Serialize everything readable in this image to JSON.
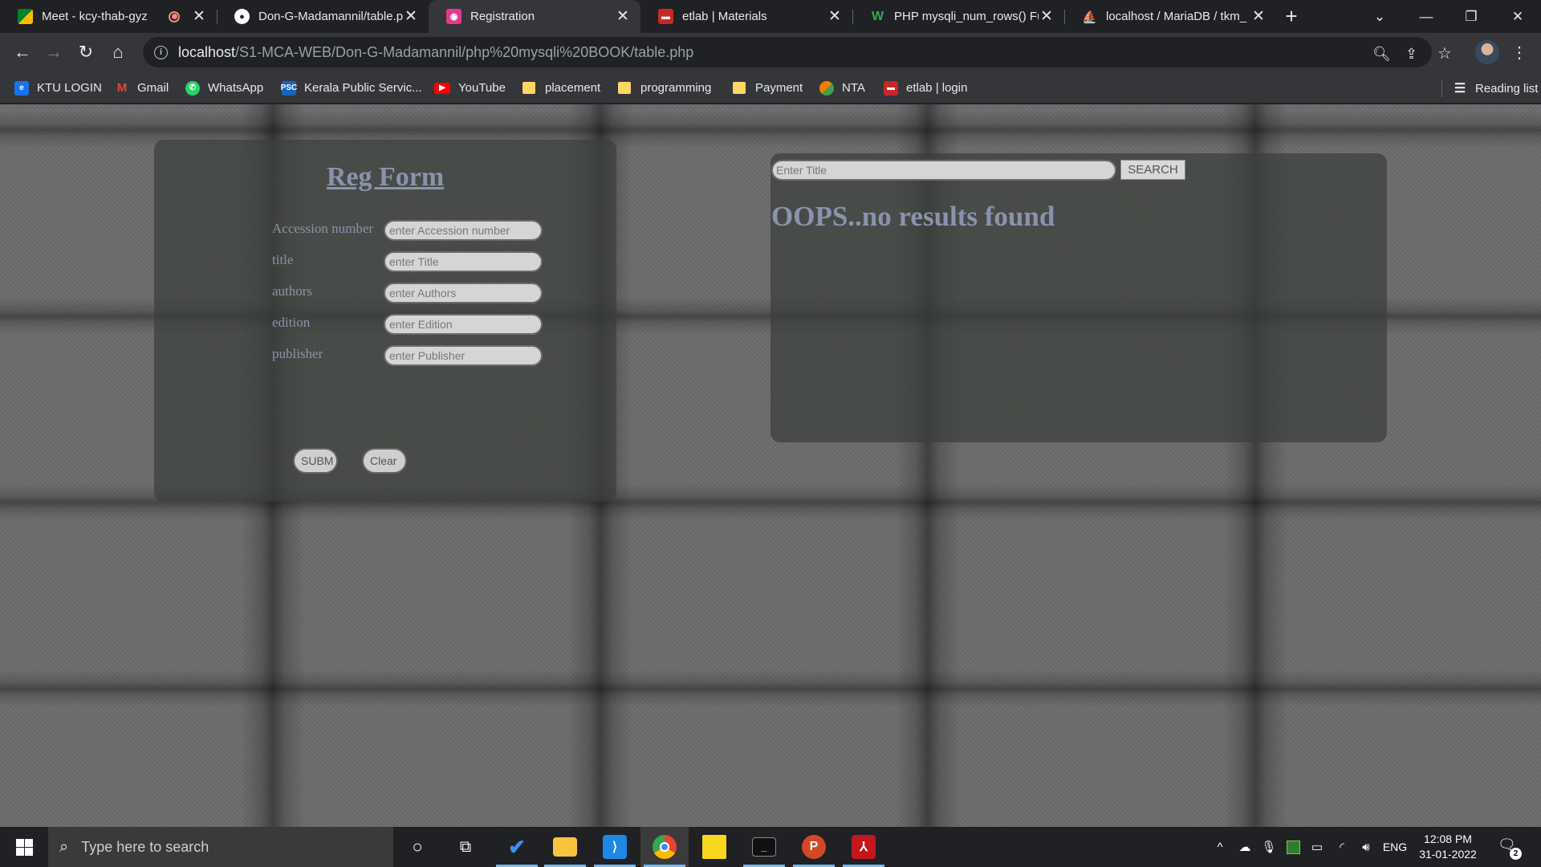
{
  "browser": {
    "tabs": [
      {
        "title": "Meet - kcy-thab-gyz",
        "favicon": "google-meet-icon"
      },
      {
        "title": "Don-G-Madamannil/table.p",
        "favicon": "github-icon"
      },
      {
        "title": "Registration",
        "favicon": "registration-page-icon"
      },
      {
        "title": "etlab | Materials",
        "favicon": "etlab-icon"
      },
      {
        "title": "PHP mysqli_num_rows() Fu",
        "favicon": "w3resource-icon"
      },
      {
        "title": "localhost / MariaDB / tkm_",
        "favicon": "phpmyadmin-icon"
      }
    ],
    "active_tab": "Registration",
    "url_host": "localhost",
    "url_path": "/S1-MCA-WEB/Don-G-Madamannil/php%20mysqli%20BOOK/table.php"
  },
  "bookmarks": [
    {
      "label": "KTU LOGIN"
    },
    {
      "label": "Gmail"
    },
    {
      "label": "WhatsApp"
    },
    {
      "label": "Kerala Public Servic..."
    },
    {
      "label": "YouTube"
    },
    {
      "label": "placement"
    },
    {
      "label": "programming"
    },
    {
      "label": "Payment"
    },
    {
      "label": "NTA"
    },
    {
      "label": "etlab | login"
    }
  ],
  "reading_list_label": "Reading list",
  "reg_form": {
    "title": "Reg Form",
    "fields": [
      {
        "label": "Accession number",
        "placeholder": "enter Accession number",
        "value": ""
      },
      {
        "label": "title",
        "placeholder": "enter Title",
        "value": ""
      },
      {
        "label": "authors",
        "placeholder": "enter Authors",
        "value": ""
      },
      {
        "label": "edition",
        "placeholder": "enter Edition",
        "value": ""
      },
      {
        "label": "publisher",
        "placeholder": "enter Publisher",
        "value": ""
      }
    ],
    "submit_label": "SUBM",
    "clear_label": "Clear"
  },
  "search": {
    "placeholder": "Enter Title",
    "value": "",
    "button_label": "SEARCH",
    "result_message": "OOPS..no results found"
  },
  "taskbar": {
    "search_placeholder": "Type here to search",
    "language": "ENG",
    "time": "12:08 PM",
    "date": "31-01-2022",
    "notification_count": "2"
  },
  "colors": {
    "form_accent": "#8a93ad",
    "tab_bar": "#202124",
    "toolbar": "#35363a"
  }
}
